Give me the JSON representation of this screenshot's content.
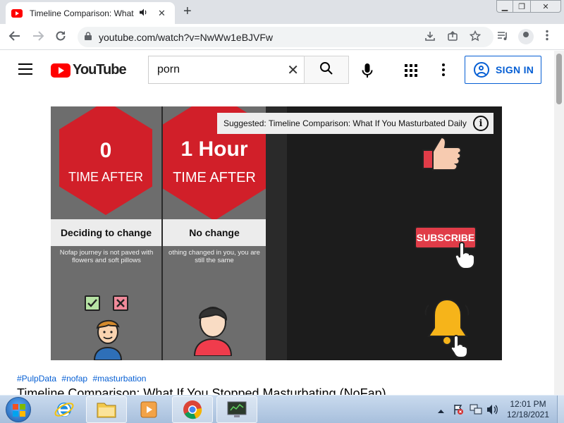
{
  "browser": {
    "tab": {
      "title": "Timeline Comparison: What If",
      "audio_icon": "speaker-icon",
      "close_glyph": "✕"
    },
    "new_tab_glyph": "+",
    "window_controls": {
      "minimize": "▁",
      "maximize": "❐",
      "close": "✕"
    },
    "address": {
      "url": "youtube.com/watch?v=NwWw1eBJVFw"
    }
  },
  "youtube": {
    "logo_text": "YouTube",
    "search": {
      "query": "porn",
      "clear_glyph": "✕"
    },
    "signin_label": "SIGN IN"
  },
  "video": {
    "suggestion": "Suggested: Timeline Comparison: What If You Masturbated Daily",
    "info_glyph": "i",
    "panels": [
      {
        "number": "0",
        "time_label": "TIME AFTER",
        "heading": "Deciding to change",
        "description": "Nofap journey is not paved with flowers and soft pillows"
      },
      {
        "number": "1 Hour",
        "time_label": "TIME AFTER",
        "heading": "No change",
        "description": "othing changed in you, you are still the same"
      }
    ],
    "subscribe_label": "SUBSCRIBE"
  },
  "below_video": {
    "hashtags": [
      "#PulpData",
      "#nofap",
      "#masturbation"
    ],
    "title": "Timeline Comparison: What If You Stopped Masturbating (NoFap)"
  },
  "taskbar": {
    "clock_time": "12:01 PM",
    "clock_date": "12/18/2021",
    "apps": [
      "internet-explorer-icon",
      "file-explorer-icon",
      "media-player-icon",
      "chrome-icon",
      "monitor-icon"
    ]
  },
  "colors": {
    "yt_red": "#ff0000",
    "link_blue": "#065fd4",
    "hex_red": "#d11f29"
  }
}
